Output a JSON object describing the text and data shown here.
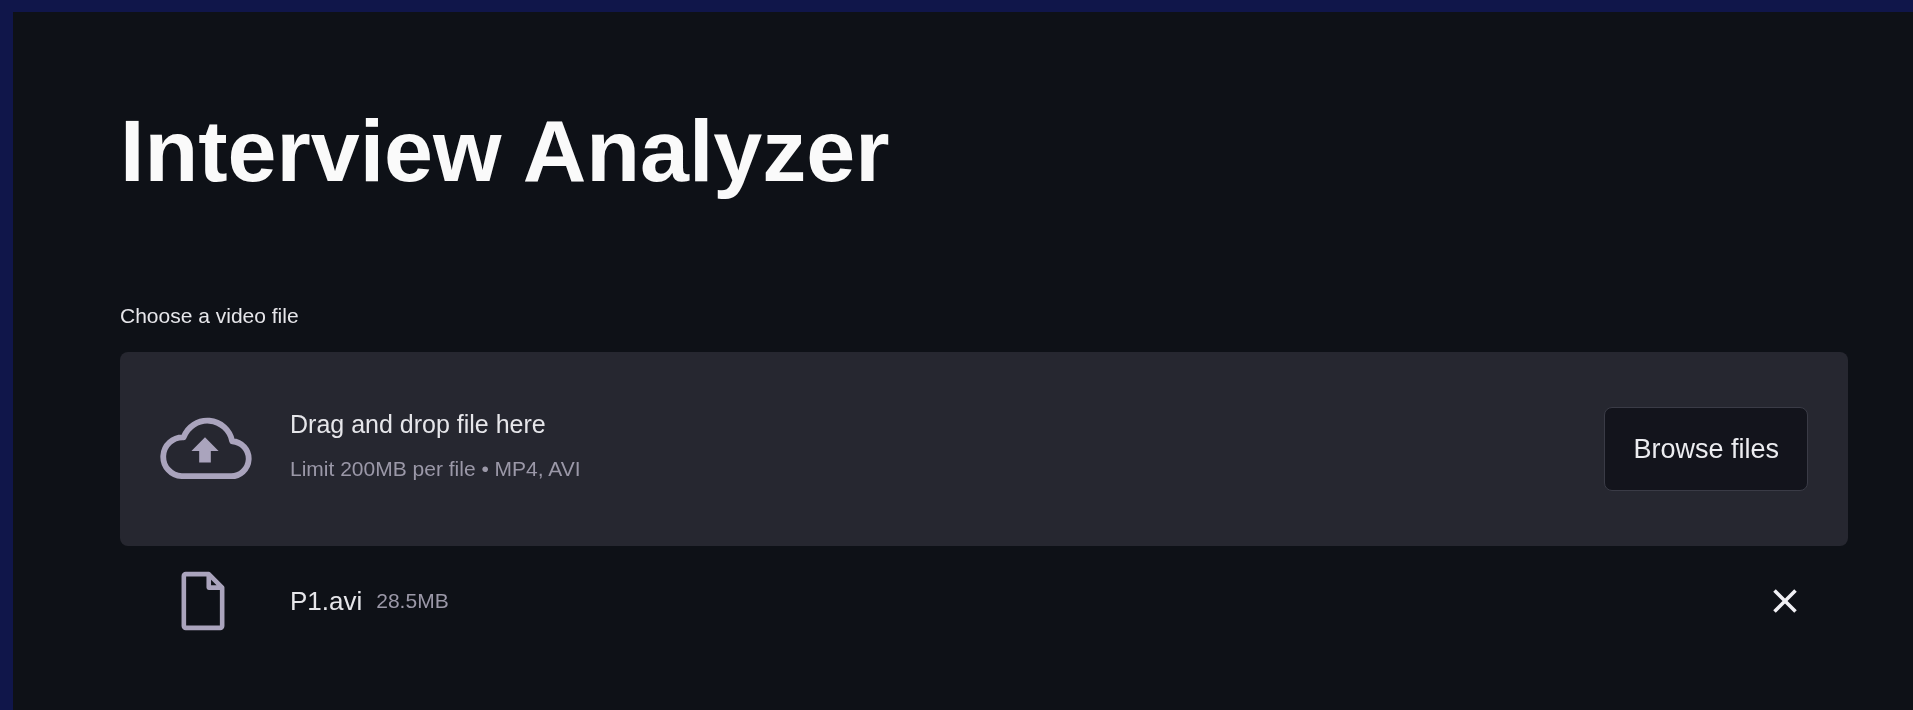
{
  "title": "Interview Analyzer",
  "uploader": {
    "label": "Choose a video file",
    "instruction": "Drag and drop file here",
    "limits": "Limit 200MB per file • MP4, AVI",
    "button": "Browse files"
  },
  "files": [
    {
      "name": "P1.avi",
      "size": "28.5MB"
    }
  ]
}
